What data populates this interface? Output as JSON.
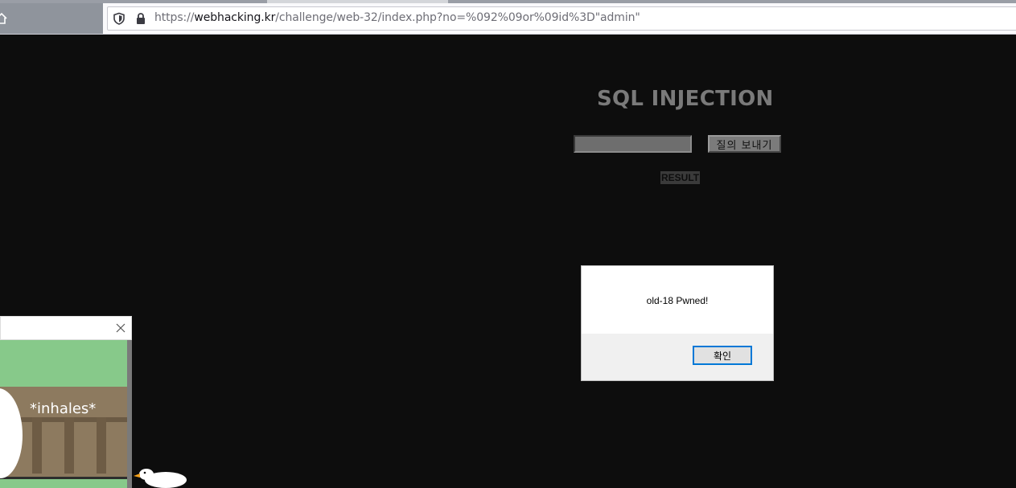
{
  "browser": {
    "url_prefix": "https://",
    "url_host": "webhacking.kr",
    "url_path": "/challenge/web-32/index.php?no=%092%09or%09id%3D\"admin\""
  },
  "page": {
    "title": "SQL INJECTION",
    "input_value": "",
    "submit_label": "질의 보내기",
    "result_label": "RESULT"
  },
  "dialog": {
    "message": "old-18 Pwned!",
    "ok_label": "확인"
  },
  "widget": {
    "speech": "*inhales*"
  },
  "colors": {
    "page_background": "#0d0d0d",
    "title": "#7a7a7a",
    "dialog_button_border": "#0078d7"
  }
}
